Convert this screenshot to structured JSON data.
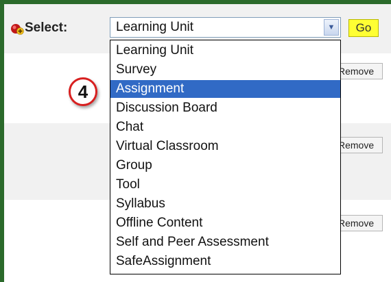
{
  "toolbar": {
    "select_label": "Select:",
    "select_value": "Learning Unit",
    "go_label": "Go"
  },
  "rows": [
    {
      "remove_label": "Remove"
    },
    {
      "remove_label": "Remove"
    },
    {
      "remove_label": "Remove"
    }
  ],
  "dropdown": {
    "options": [
      "Learning Unit",
      "Survey",
      "Assignment",
      "Discussion Board",
      "Chat",
      "Virtual Classroom",
      "Group",
      "Tool",
      "Syllabus",
      "Offline Content",
      "Self and Peer Assessment",
      "SafeAssignment"
    ],
    "highlighted": "Assignment"
  },
  "callout": {
    "number": "4"
  },
  "colors": {
    "frame": "#2b6a2b",
    "go_button": "#ffff33",
    "highlight": "#316ac5",
    "callout_border": "#d82020"
  },
  "icons": {
    "add": "add-content-icon",
    "dropdown_arrow": "chevron-down-icon"
  }
}
